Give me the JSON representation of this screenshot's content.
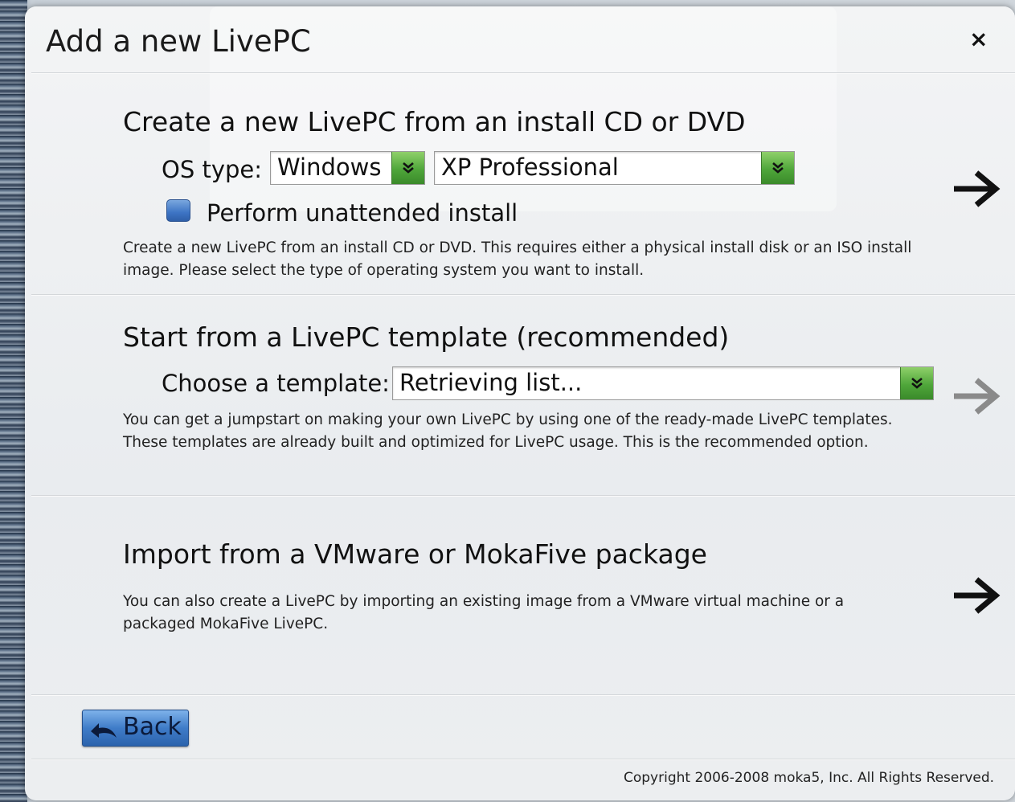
{
  "dialog": {
    "title": "Add a new LivePC",
    "close_symbol": "×"
  },
  "section_install": {
    "heading": "Create a new LivePC from an install CD or DVD",
    "os_type_label": "OS type:",
    "os_family_value": "Windows",
    "os_version_value": "XP Professional",
    "unattended_label": "Perform unattended install",
    "unattended_checked": false,
    "description": "Create a new LivePC from an install CD or DVD. This requires either a physical install disk or an ISO install image. Please select the type of operating system you want to install.",
    "arrow_icon": "arrow-right-icon",
    "arrow_color": "#111111"
  },
  "section_template": {
    "heading": "Start from a LivePC template (recommended)",
    "choose_label": "Choose a template:",
    "template_value": "Retrieving list...",
    "description": "You can get a jumpstart on making your own LivePC by using one of the ready-made LivePC templates. These templates are already built and optimized for LivePC usage. This is the recommended option.",
    "arrow_icon": "arrow-right-icon",
    "arrow_color": "#8a8a8a",
    "arrow_disabled": true
  },
  "section_import": {
    "heading": "Import from a VMware or MokaFive package",
    "description": "You can also create a LivePC by importing an existing image from a VMware virtual machine or a packaged MokaFive LivePC.",
    "arrow_icon": "arrow-right-icon",
    "arrow_color": "#111111"
  },
  "footer": {
    "back_label": "Back",
    "back_icon": "back-arrow-icon",
    "copyright": "Copyright 2006-2008 moka5, Inc. All Rights Reserved."
  },
  "colors": {
    "dropdown_button": "#4fa63a",
    "checkbox": "#3d74c4",
    "back_button": "#3f7cc8"
  }
}
